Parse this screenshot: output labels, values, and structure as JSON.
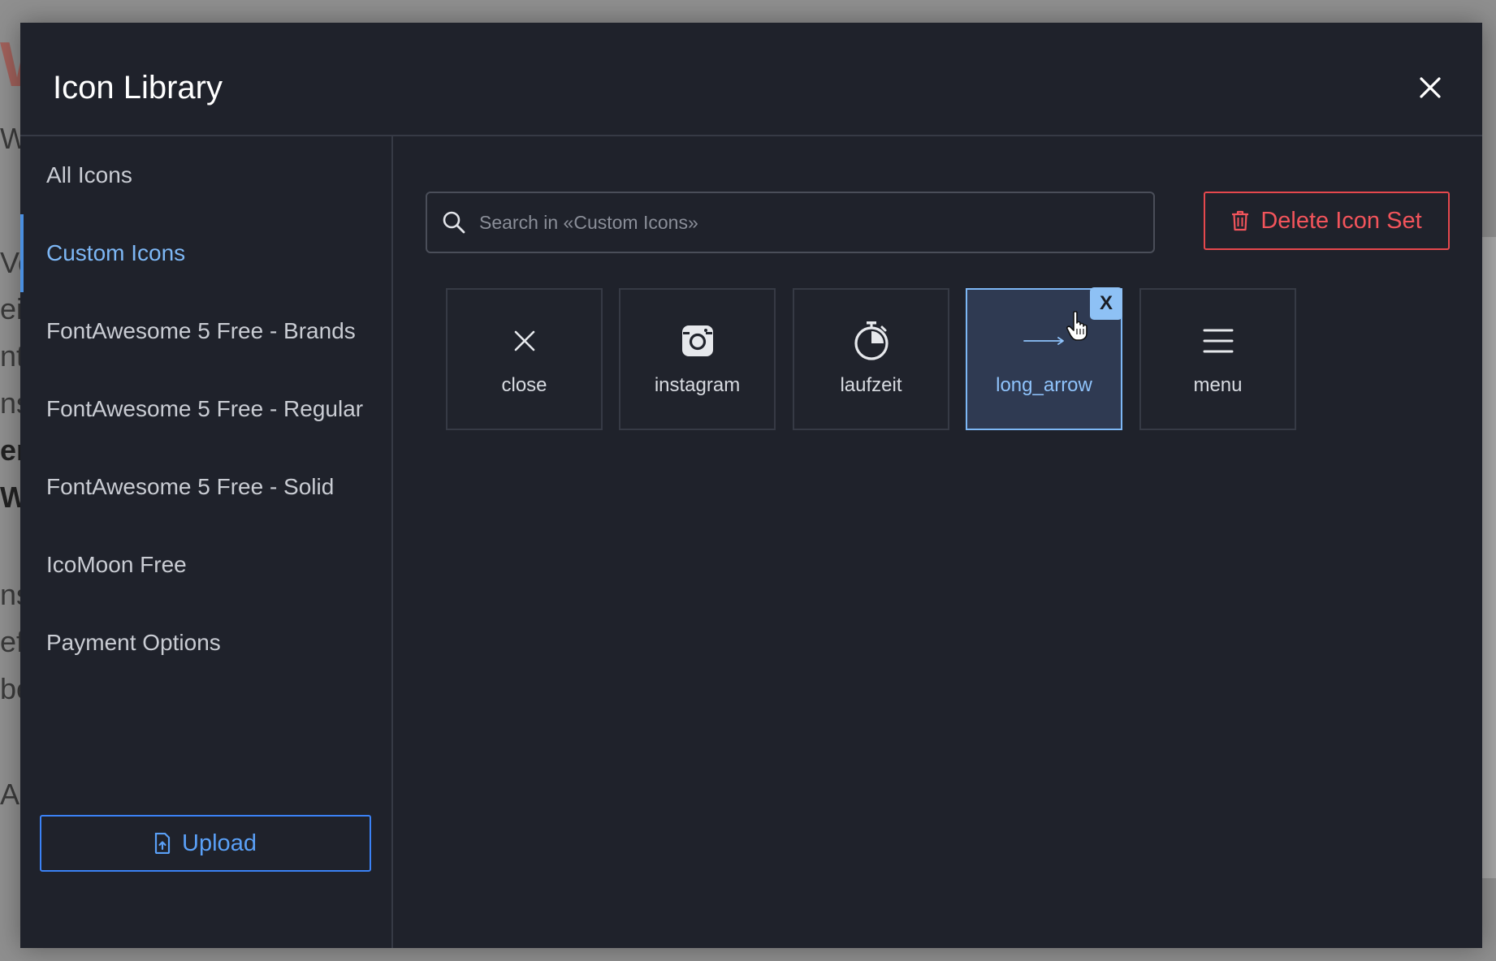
{
  "background_fragments": [
    "W",
    "Wl",
    "Vo",
    "eis",
    "nte",
    "ns",
    "er",
    "We",
    "ns",
    "ef",
    "be",
    "AN"
  ],
  "modal": {
    "title": "Icon Library",
    "close_icon": "close-icon"
  },
  "sidebar": {
    "items": [
      {
        "label": "All Icons",
        "active": false
      },
      {
        "label": "Custom Icons",
        "active": true
      },
      {
        "label": "FontAwesome 5 Free - Brands",
        "active": false
      },
      {
        "label": "FontAwesome 5 Free - Regular",
        "active": false
      },
      {
        "label": "FontAwesome 5 Free - Solid",
        "active": false
      },
      {
        "label": "IcoMoon Free",
        "active": false
      },
      {
        "label": "Payment Options",
        "active": false
      }
    ],
    "upload_label": "Upload",
    "upload_icon": "file-upload-icon"
  },
  "search": {
    "placeholder": "Search in «Custom Icons»",
    "value": "",
    "icon": "search-icon"
  },
  "delete_set": {
    "label": "Delete Icon Set",
    "icon": "trash-icon"
  },
  "icons": [
    {
      "name": "close",
      "icon": "close-icon",
      "selected": false
    },
    {
      "name": "instagram",
      "icon": "instagram-icon",
      "selected": false
    },
    {
      "name": "laufzeit",
      "icon": "stopwatch-icon",
      "selected": false
    },
    {
      "name": "long_arrow",
      "icon": "long-arrow-icon",
      "selected": true
    },
    {
      "name": "menu",
      "icon": "menu-icon",
      "selected": false
    }
  ],
  "remove_badge_label": "X",
  "colors": {
    "accent": "#3b82f6",
    "danger": "#e5484d",
    "modal_bg": "#1f222b",
    "selected_tile": "#2f3a52"
  }
}
